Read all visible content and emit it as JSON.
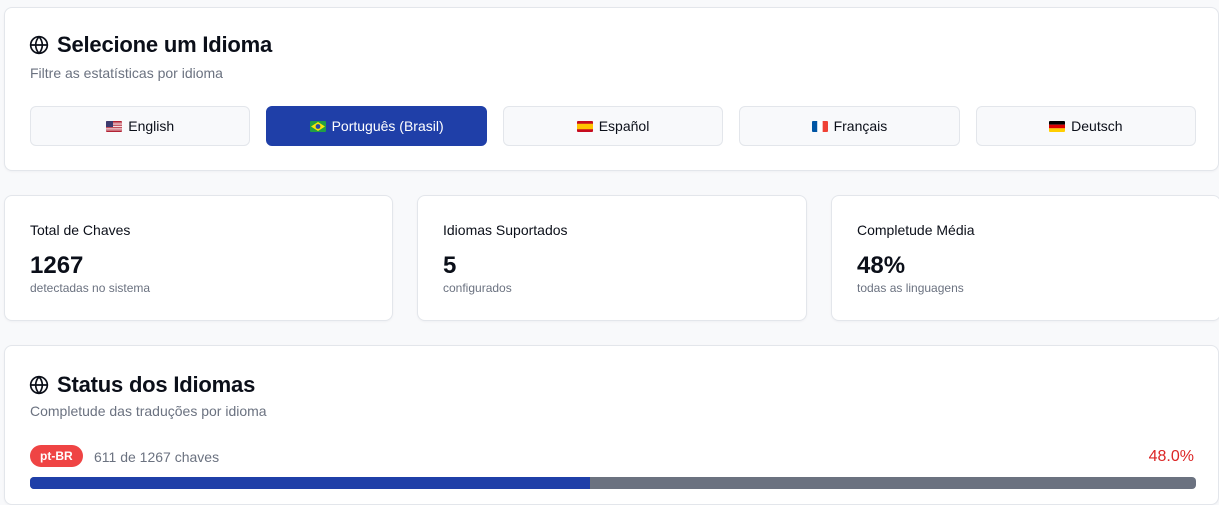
{
  "language_selector": {
    "title": "Selecione um Idioma",
    "subtitle": "Filtre as estatísticas por idioma",
    "languages": [
      {
        "label": "English",
        "flag": "us-flag-icon",
        "active": false
      },
      {
        "label": "Português (Brasil)",
        "flag": "br-flag-icon",
        "active": true
      },
      {
        "label": "Español",
        "flag": "es-flag-icon",
        "active": false
      },
      {
        "label": "Français",
        "flag": "fr-flag-icon",
        "active": false
      },
      {
        "label": "Deutsch",
        "flag": "de-flag-icon",
        "active": false
      }
    ]
  },
  "stats": [
    {
      "label": "Total de Chaves",
      "value": "1267",
      "desc": "detectadas no sistema"
    },
    {
      "label": "Idiomas Suportados",
      "value": "5",
      "desc": "configurados"
    },
    {
      "label": "Completude Média",
      "value": "48%",
      "desc": "todas as linguagens"
    }
  ],
  "status": {
    "title": "Status dos Idiomas",
    "subtitle": "Completude das traduções por idioma",
    "items": [
      {
        "code": "pt-BR",
        "keys_text": "611 de 1267 chaves",
        "percent_text": "48.0%",
        "completion": 0.48
      }
    ]
  },
  "colors": {
    "accent": "#1f3fa8",
    "danger": "#ef4444",
    "percent_text": "#dc2626",
    "progress_track": "#6b7280"
  }
}
